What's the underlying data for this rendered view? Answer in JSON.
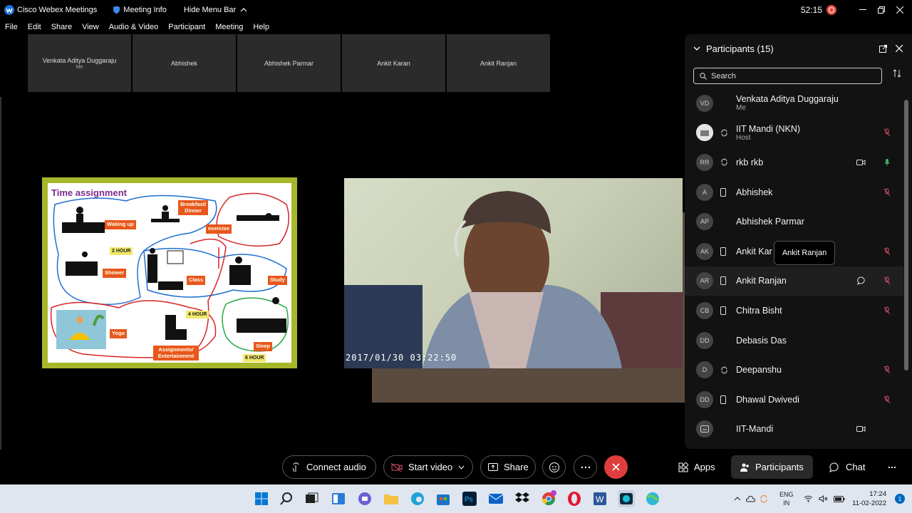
{
  "titlebar": {
    "app_name": "Cisco Webex Meetings",
    "meeting_info": "Meeting Info",
    "hide_menu": "Hide Menu Bar",
    "timer": "52:15"
  },
  "menu": [
    "File",
    "Edit",
    "Share",
    "View",
    "Audio & Video",
    "Participant",
    "Meeting",
    "Help"
  ],
  "thumbnails": [
    {
      "name": "Venkata Aditya Duggaraju",
      "sub": "Me"
    },
    {
      "name": "",
      "sub": ""
    },
    {
      "name": "Abhishek",
      "sub": ""
    },
    {
      "name": "Abhishek Parmar",
      "sub": ""
    },
    {
      "name": "Ankit Karan",
      "sub": ""
    },
    {
      "name": "Ankit Ranjan",
      "sub": ""
    }
  ],
  "slide": {
    "title": "Time assignment",
    "tags": {
      "waking": "Waking up",
      "breakfast": "Breakfast/ Dinner",
      "exercise": "exercise",
      "shower": "Shower",
      "class": "Class",
      "study": "Study",
      "yoga": "Yoga",
      "assign": "Assignments/ Entertainment",
      "sleep": "Sleep"
    },
    "durations": {
      "two": "2 HOUR",
      "four": "4 HOUR",
      "six": "6 HOUR"
    }
  },
  "video": {
    "timestamp": "2017/01/30 03:22:50"
  },
  "participants_panel": {
    "title": "Participants (15)",
    "search_placeholder": "Search",
    "tooltip": "Ankit Ranjan",
    "items": [
      {
        "initials": "VD",
        "name": "Venkata Aditya Duggaraju",
        "sub": "Me"
      },
      {
        "initials": "",
        "name": "IIT Mandi (NKN)",
        "sub": "Host"
      },
      {
        "initials": "RR",
        "name": "rkb rkb",
        "sub": ""
      },
      {
        "initials": "A",
        "name": "Abhishek",
        "sub": ""
      },
      {
        "initials": "AP",
        "name": "Abhishek Parmar",
        "sub": ""
      },
      {
        "initials": "AK",
        "name": "Ankit Kar",
        "sub": ""
      },
      {
        "initials": "AR",
        "name": "Ankit Ranjan",
        "sub": ""
      },
      {
        "initials": "CB",
        "name": "Chitra Bisht",
        "sub": ""
      },
      {
        "initials": "DD",
        "name": "Debasis Das",
        "sub": ""
      },
      {
        "initials": "D",
        "name": "Deepanshu",
        "sub": ""
      },
      {
        "initials": "DD",
        "name": "Dhawal Dwivedi",
        "sub": ""
      },
      {
        "initials": "",
        "name": "IIT-Mandi",
        "sub": ""
      }
    ]
  },
  "controls": {
    "connect_audio": "Connect audio",
    "start_video": "Start video",
    "share": "Share",
    "apps": "Apps",
    "participants": "Participants",
    "chat": "Chat"
  },
  "taskbar": {
    "lang": "ENG",
    "region": "IN",
    "time": "17:24",
    "date": "11-02-2022",
    "notifications": "1"
  },
  "colors": {
    "end_call": "#e03e3e",
    "accent_mute": "#e0526e",
    "slide_border": "#a6b82a"
  }
}
